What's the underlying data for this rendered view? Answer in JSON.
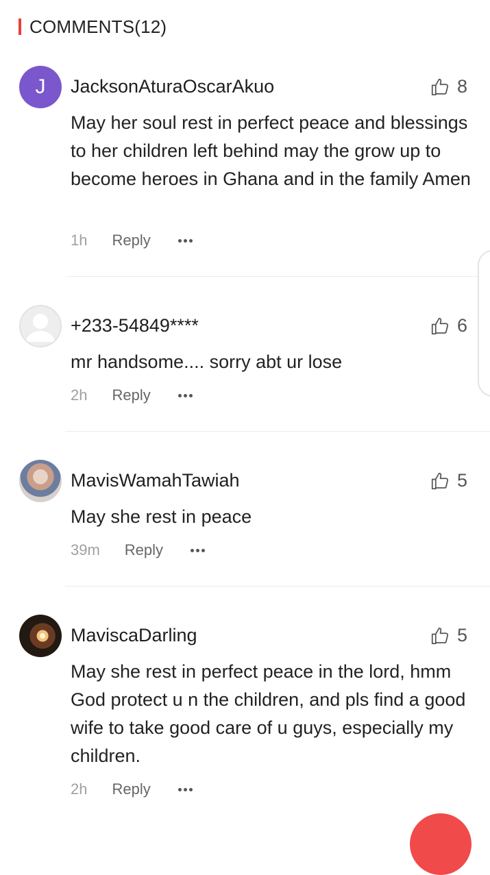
{
  "header": {
    "title": "COMMENTS(12)",
    "accent_color": "#e8403a"
  },
  "comments": [
    {
      "avatar": {
        "type": "letter",
        "letter": "J",
        "color": "#7a57cc"
      },
      "name": "JacksonAturaOscarAkuo",
      "likes": "8",
      "text": "May her soul rest in perfect peace and blessings to her children left behind may the grow up to become heroes in Ghana and in the family  Amen",
      "time": "1h",
      "reply_label": "Reply"
    },
    {
      "avatar": {
        "type": "default-user-icon"
      },
      "name": "+233-54849****",
      "likes": "6",
      "text": "mr handsome.... sorry abt ur lose",
      "time": "2h",
      "reply_label": "Reply"
    },
    {
      "avatar": {
        "type": "photo"
      },
      "name": "MavisWamahTawiah",
      "likes": "5",
      "text": "May she rest in peace",
      "time": "39m",
      "reply_label": "Reply"
    },
    {
      "avatar": {
        "type": "photo"
      },
      "name": "MaviscaDarling",
      "likes": "5",
      "text": "May she rest in perfect peace in the lord, hmm God protect u n the children, and pls find a good wife to take good care of u guys, especially my children.",
      "time": "2h",
      "reply_label": "Reply"
    }
  ],
  "icons": {
    "like": "thumbs-up-icon",
    "more": "more-dots-icon"
  }
}
